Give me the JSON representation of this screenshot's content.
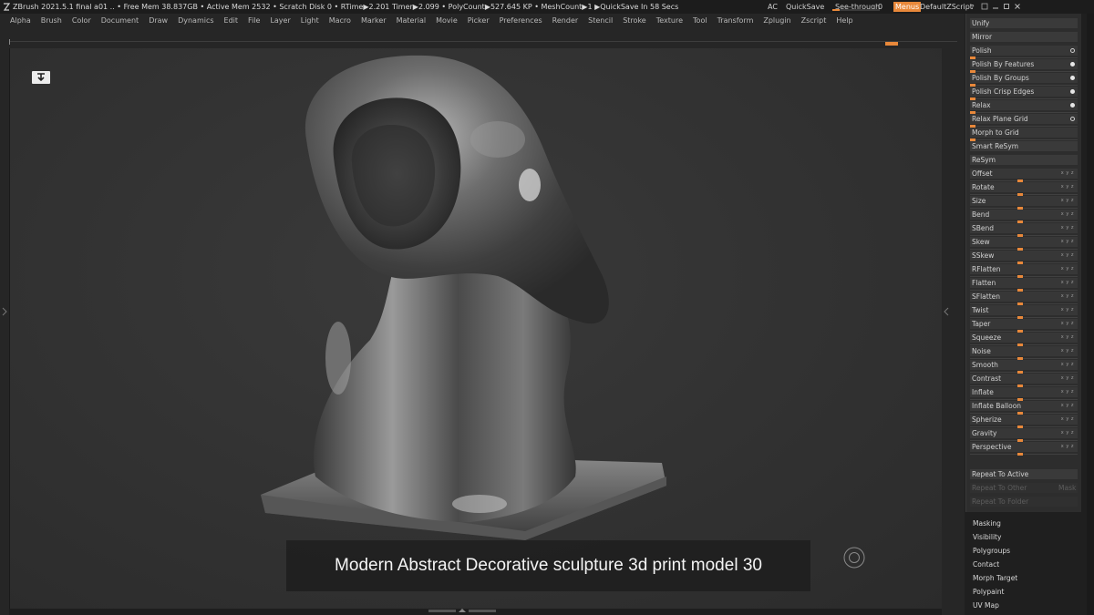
{
  "titlebar": {
    "status": "ZBrush 2021.5.1    final a01    ..  • Free Mem 38.837GB • Active Mem 2532 • Scratch Disk 0 •  RTime▶2.201 Timer▶2.099 • PolyCount▶527.645 KP  • MeshCount▶1  ▶QuickSave In 58 Secs",
    "ac": "AC",
    "quicksave": "QuickSave",
    "see_through": "See-through",
    "see_through_value": "0",
    "menus": "Menus",
    "default_zscript": "DefaultZScript"
  },
  "menubar": [
    "Alpha",
    "Brush",
    "Color",
    "Document",
    "Draw",
    "Dynamics",
    "Edit",
    "File",
    "Layer",
    "Light",
    "Macro",
    "Marker",
    "Material",
    "Movie",
    "Picker",
    "Preferences",
    "Render",
    "Stencil",
    "Stroke",
    "Texture",
    "Tool",
    "Transform",
    "Zplugin",
    "Zscript",
    "Help"
  ],
  "viewport": {
    "caption": "Modern Abstract Decorative sculpture 3d print model 30"
  },
  "panel": {
    "deformation_rows": [
      {
        "label": "Unify",
        "kind": "header"
      },
      {
        "label": "Mirror",
        "kind": "header"
      },
      {
        "label": "Polish",
        "kind": "ring"
      },
      {
        "label": "Polish By Features",
        "kind": "dot"
      },
      {
        "label": "Polish By Groups",
        "kind": "dot"
      },
      {
        "label": "Polish Crisp Edges",
        "kind": "dot"
      },
      {
        "label": "Relax",
        "kind": "dot"
      },
      {
        "label": "Relax Plane Grid",
        "kind": "ring"
      },
      {
        "label": "Morph to Grid",
        "kind": "slider"
      },
      {
        "label": "Smart ReSym",
        "kind": "header"
      },
      {
        "label": "ReSym",
        "kind": "header"
      },
      {
        "label": "Offset",
        "kind": "xyz"
      },
      {
        "label": "Rotate",
        "kind": "xyz"
      },
      {
        "label": "Size",
        "kind": "xyz"
      },
      {
        "label": "Bend",
        "kind": "xyz"
      },
      {
        "label": "SBend",
        "kind": "xyz"
      },
      {
        "label": "Skew",
        "kind": "xyz"
      },
      {
        "label": "SSkew",
        "kind": "xyz"
      },
      {
        "label": "RFlatten",
        "kind": "xyz"
      },
      {
        "label": "Flatten",
        "kind": "xyz"
      },
      {
        "label": "SFlatten",
        "kind": "xyz"
      },
      {
        "label": "Twist",
        "kind": "xyz"
      },
      {
        "label": "Taper",
        "kind": "xyz"
      },
      {
        "label": "Squeeze",
        "kind": "xyz"
      },
      {
        "label": "Noise",
        "kind": "xyz"
      },
      {
        "label": "Smooth",
        "kind": "xyz"
      },
      {
        "label": "Contrast",
        "kind": "xyz"
      },
      {
        "label": "Inflate",
        "kind": "xyz"
      },
      {
        "label": "Inflate Balloon",
        "kind": "xyz"
      },
      {
        "label": "Spherize",
        "kind": "xyz"
      },
      {
        "label": "Gravity",
        "kind": "xyz"
      },
      {
        "label": "Perspective",
        "kind": "xyz"
      }
    ],
    "xyz_label": "x y z",
    "repeat_to_active": "Repeat To Active",
    "repeat_to_other": "Repeat To Other",
    "mask": "Mask",
    "repeat_to_folder": "Repeat To Folder",
    "subpalettes": [
      "Masking",
      "Visibility",
      "Polygroups",
      "Contact",
      "Morph Target",
      "Polypaint",
      "UV Map"
    ]
  }
}
